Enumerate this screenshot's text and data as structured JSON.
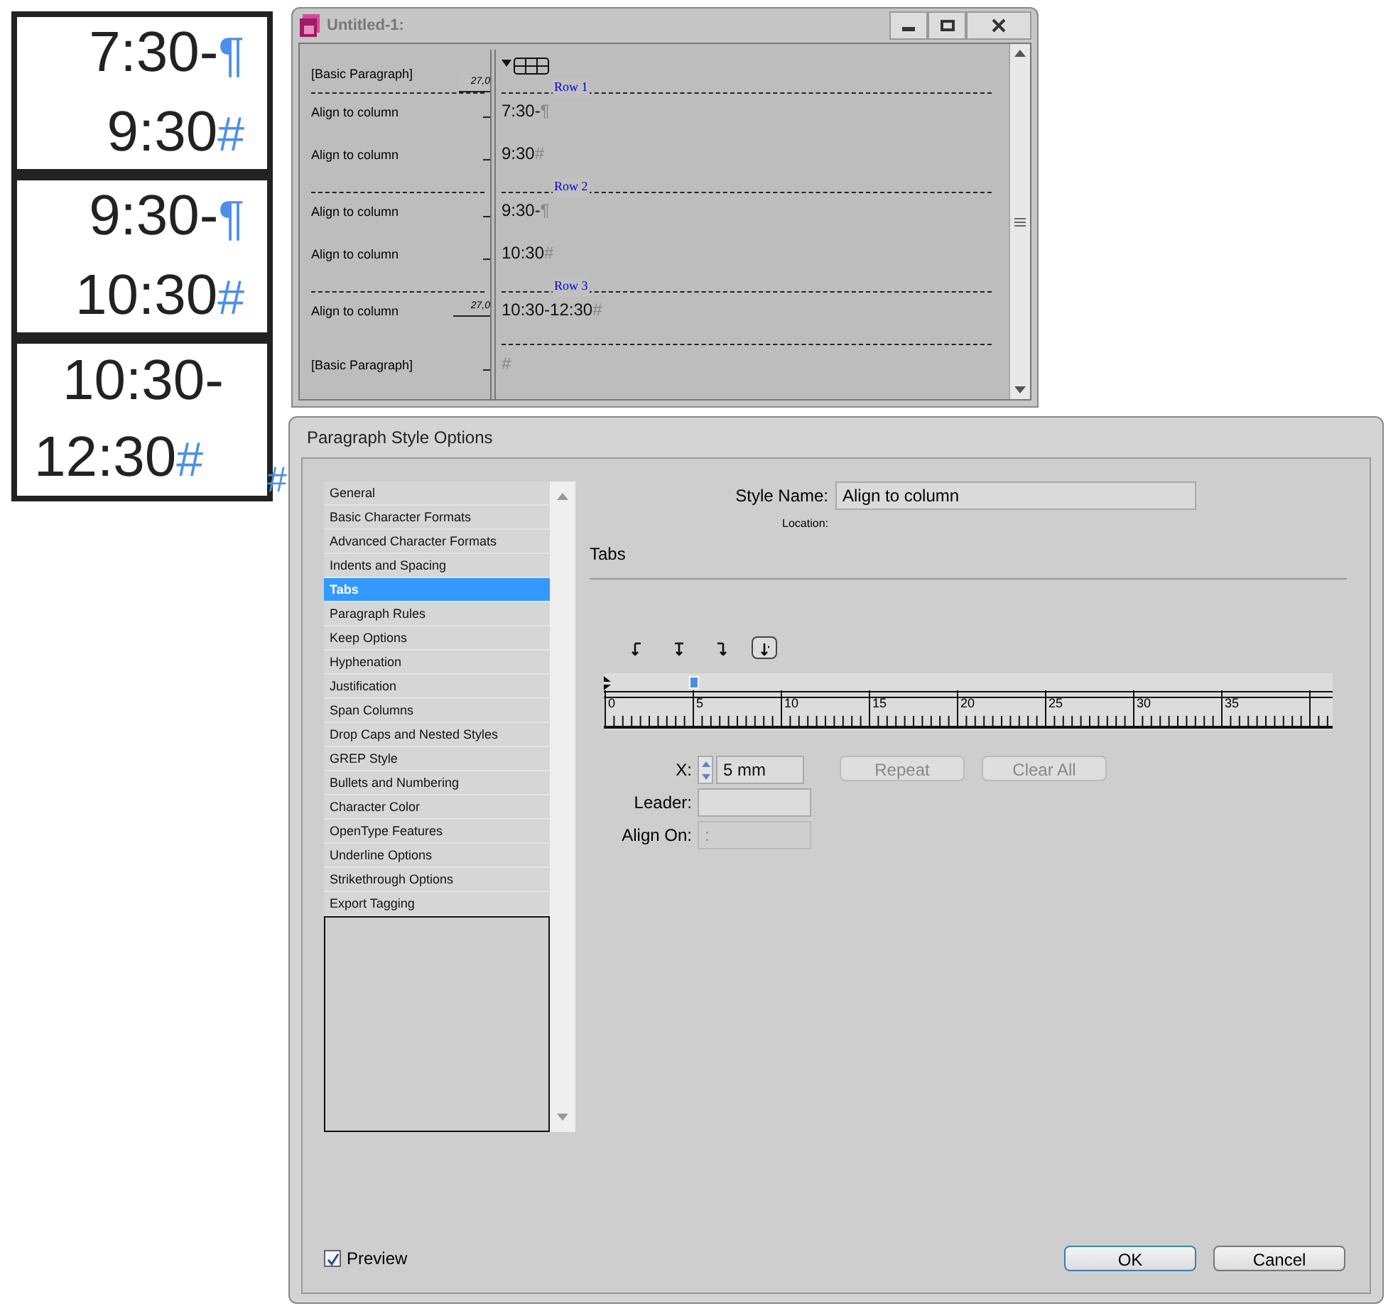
{
  "frames": [
    {
      "lines": [
        {
          "text": "7:30-",
          "mark": "¶"
        },
        {
          "text": "9:30",
          "mark": "#"
        }
      ]
    },
    {
      "lines": [
        {
          "text": "9:30-",
          "mark": "¶"
        },
        {
          "text": "10:30",
          "mark": "#"
        }
      ]
    },
    {
      "lines": [
        {
          "text": "10:30-"
        },
        {
          "text": "12:30",
          "mark": "#"
        }
      ]
    }
  ],
  "overset_mark": "#",
  "story_window": {
    "title": "Untitled-1:",
    "entries": [
      {
        "kind": "table-anchor",
        "style": "[Basic Paragraph]"
      },
      {
        "kind": "row",
        "label": "Row 1",
        "depth": "27,0"
      },
      {
        "kind": "paragraph",
        "style": "Align to column",
        "text": "7:30-",
        "mark": "¶"
      },
      {
        "kind": "paragraph",
        "style": "Align to column",
        "text": "9:30",
        "mark": "#"
      },
      {
        "kind": "row",
        "label": "Row 2"
      },
      {
        "kind": "paragraph",
        "style": "Align to column",
        "text": "9:30-",
        "mark": "¶"
      },
      {
        "kind": "paragraph",
        "style": "Align to column",
        "text": "10:30",
        "mark": "#"
      },
      {
        "kind": "row",
        "label": "Row 3"
      },
      {
        "kind": "paragraph",
        "style": "Align to column",
        "depth": "27,0",
        "text": "10:30-12:30",
        "mark": "#"
      },
      {
        "kind": "table-end"
      },
      {
        "kind": "paragraph",
        "style": "[Basic Paragraph]",
        "mark": "#"
      }
    ]
  },
  "dialog": {
    "title": "Paragraph Style Options",
    "categories": [
      {
        "label": "General",
        "selected": false
      },
      {
        "label": "Basic Character Formats",
        "selected": false
      },
      {
        "label": "Advanced Character Formats",
        "selected": false
      },
      {
        "label": "Indents and Spacing",
        "selected": false
      },
      {
        "label": "Tabs",
        "selected": true
      },
      {
        "label": "Paragraph Rules",
        "selected": false
      },
      {
        "label": "Keep Options",
        "selected": false
      },
      {
        "label": "Hyphenation",
        "selected": false
      },
      {
        "label": "Justification",
        "selected": false
      },
      {
        "label": "Span Columns",
        "selected": false
      },
      {
        "label": "Drop Caps and Nested Styles",
        "selected": false
      },
      {
        "label": "GREP Style",
        "selected": false
      },
      {
        "label": "Bullets and Numbering",
        "selected": false
      },
      {
        "label": "Character Color",
        "selected": false
      },
      {
        "label": "OpenType Features",
        "selected": false
      },
      {
        "label": "Underline Options",
        "selected": false
      },
      {
        "label": "Strikethrough Options",
        "selected": false
      },
      {
        "label": "Export Tagging",
        "selected": false
      }
    ],
    "style_name": {
      "label": "Style Name:",
      "value": "Align to column"
    },
    "location_label": "Location:",
    "section_title": "Tabs",
    "tab_alignments": [
      {
        "kind": "left",
        "selected": false
      },
      {
        "kind": "center",
        "selected": false
      },
      {
        "kind": "right",
        "selected": false
      },
      {
        "kind": "decimal",
        "selected": true
      }
    ],
    "ruler_ticks": [
      {
        "label": "0",
        "tab_stop": false
      },
      {
        "label": "5",
        "tab_stop": true
      },
      {
        "label": "10",
        "tab_stop": false
      },
      {
        "label": "15",
        "tab_stop": false
      },
      {
        "label": "20",
        "tab_stop": false
      },
      {
        "label": "25",
        "tab_stop": false
      },
      {
        "label": "30",
        "tab_stop": false
      },
      {
        "label": "35",
        "tab_stop": false
      }
    ],
    "fields": [
      {
        "kind": "spinner",
        "label": "X:",
        "value": "5 mm",
        "disabled": false
      },
      {
        "kind": "text",
        "label": "Leader:",
        "disabled": false
      },
      {
        "kind": "text",
        "label": "Align On:",
        "value": ":",
        "disabled": true
      }
    ],
    "buttons": [
      {
        "label": "Repeat",
        "disabled": true
      },
      {
        "label": "Clear All",
        "disabled": true
      }
    ],
    "preview": {
      "label": "Preview",
      "checked": true
    },
    "footer_buttons": [
      {
        "label": "OK",
        "default": true
      },
      {
        "label": "Cancel",
        "default": false
      }
    ]
  }
}
